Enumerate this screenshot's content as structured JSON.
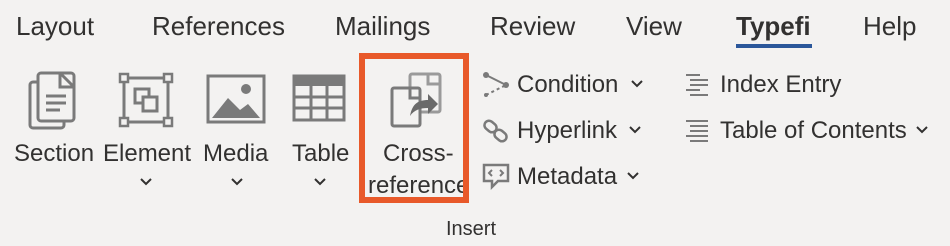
{
  "tabs": [
    {
      "label": "Layout"
    },
    {
      "label": "References"
    },
    {
      "label": "Mailings"
    },
    {
      "label": "Review"
    },
    {
      "label": "View"
    },
    {
      "label": "Typefi"
    },
    {
      "label": "Help"
    }
  ],
  "active_tab": "Typefi",
  "ribbon": {
    "group_label": "Insert",
    "large_buttons": [
      {
        "label": "Section",
        "icon": "section-icon",
        "has_dropdown": false
      },
      {
        "label": "Element",
        "icon": "element-icon",
        "has_dropdown": true
      },
      {
        "label": "Media",
        "icon": "media-icon",
        "has_dropdown": true
      },
      {
        "label": "Table",
        "icon": "table-icon",
        "has_dropdown": true
      },
      {
        "label_line1": "Cross-",
        "label_line2": "reference",
        "icon": "cross-reference-icon",
        "has_dropdown": false,
        "highlighted": true
      }
    ],
    "small_buttons_col1": [
      {
        "label": "Condition",
        "icon": "condition-icon",
        "has_dropdown": true
      },
      {
        "label": "Hyperlink",
        "icon": "hyperlink-icon",
        "has_dropdown": true
      },
      {
        "label": "Metadata",
        "icon": "metadata-icon",
        "has_dropdown": true
      }
    ],
    "small_buttons_col2": [
      {
        "label": "Index Entry",
        "icon": "index-entry-icon",
        "has_dropdown": false
      },
      {
        "label": "Table of Contents",
        "icon": "table-of-contents-icon",
        "has_dropdown": true
      }
    ]
  },
  "colors": {
    "background": "#f3f2f1",
    "active_tab_underline": "#2b579a",
    "highlight_border": "#e8592a",
    "icon_gray": "#7a7a7a"
  }
}
